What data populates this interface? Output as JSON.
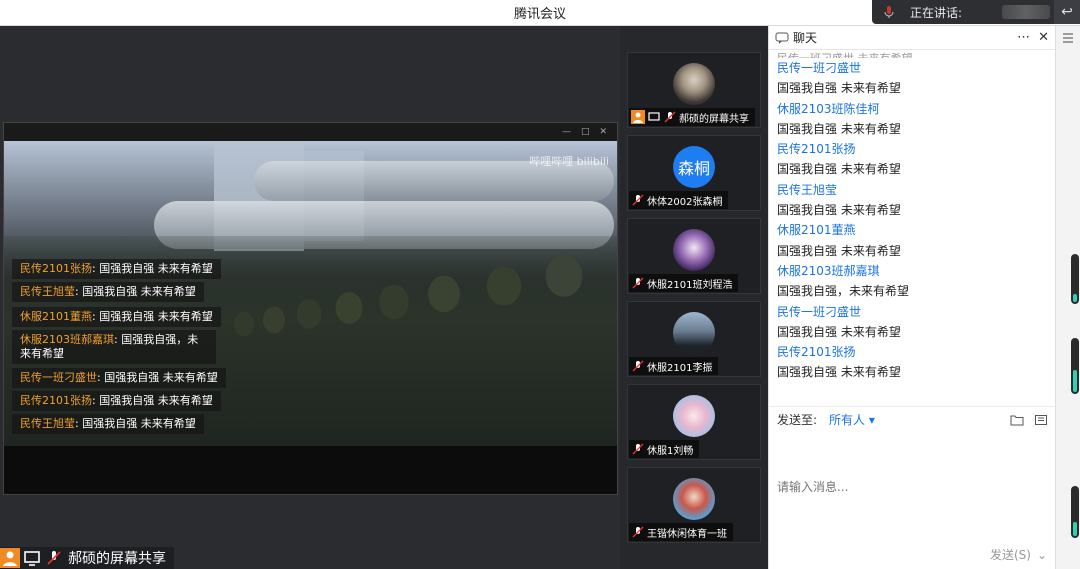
{
  "window": {
    "title": "腾讯会议"
  },
  "speaking": {
    "label": "正在讲话:"
  },
  "stage": {
    "label": "郝硕的屏幕共享",
    "video_watermark": "哔哩哔哩 bilibili",
    "danmu": [
      {
        "name": "民传2101张扬",
        "text": "国强我自强 未来有希望"
      },
      {
        "name": "民传王旭莹",
        "text": "国强我自强 未来有希望"
      },
      {
        "name": "休服2101董燕",
        "text": "国强我自强 未来有希望"
      },
      {
        "name": "休服2103班郝嘉琪",
        "text": "国强我自强，未来有希望"
      },
      {
        "name": "民传一班刁盛世",
        "text": "国强我自强 未来有希望"
      },
      {
        "name": "民传2101张扬",
        "text": "国强我自强 未来有希望"
      },
      {
        "name": "民传王旭莹",
        "text": "国强我自强 未来有希望"
      }
    ]
  },
  "participants": [
    {
      "name": "郝硕的屏幕共享",
      "avatar": "photo-dark"
    },
    {
      "name": "休体2002张森桐",
      "avatar": "text",
      "initials": "森桐"
    },
    {
      "name": "休服2101班刘程浩",
      "avatar": "anime-purple"
    },
    {
      "name": "休服2101李振",
      "avatar": "photo-sky"
    },
    {
      "name": "休服1刘畅",
      "avatar": "anime-pink"
    },
    {
      "name": "王锴休闲体育一班",
      "avatar": "anime-blue"
    }
  ],
  "chat": {
    "title": "聊天",
    "clipped_top": "民传一班刁盛世 未来有希望",
    "messages": [
      {
        "user": "民传一班刁盛世",
        "text": "国强我自强 未来有希望"
      },
      {
        "user": "休服2103班陈佳柯",
        "text": "国强我自强 未来有希望"
      },
      {
        "user": "民传2101张扬",
        "text": "国强我自强 未来有希望"
      },
      {
        "user": "民传王旭莹",
        "text": "国强我自强 未来有希望"
      },
      {
        "user": "休服2101董燕",
        "text": "国强我自强 未来有希望"
      },
      {
        "user": "休服2103班郝嘉琪",
        "text": "国强我自强，未来有希望"
      },
      {
        "user": "民传一班刁盛世",
        "text": "国强我自强 未来有希望"
      },
      {
        "user": "民传2101张扬",
        "text": "国强我自强 未来有希望"
      }
    ],
    "send_to_label": "发送至:",
    "send_to_value": "所有人",
    "input_placeholder": "请输入消息...",
    "send_label": "发送(S)"
  },
  "colors": {
    "accent": "#1a73e8",
    "danmu_name": "#f0a030",
    "level": "#2ed1b4"
  }
}
